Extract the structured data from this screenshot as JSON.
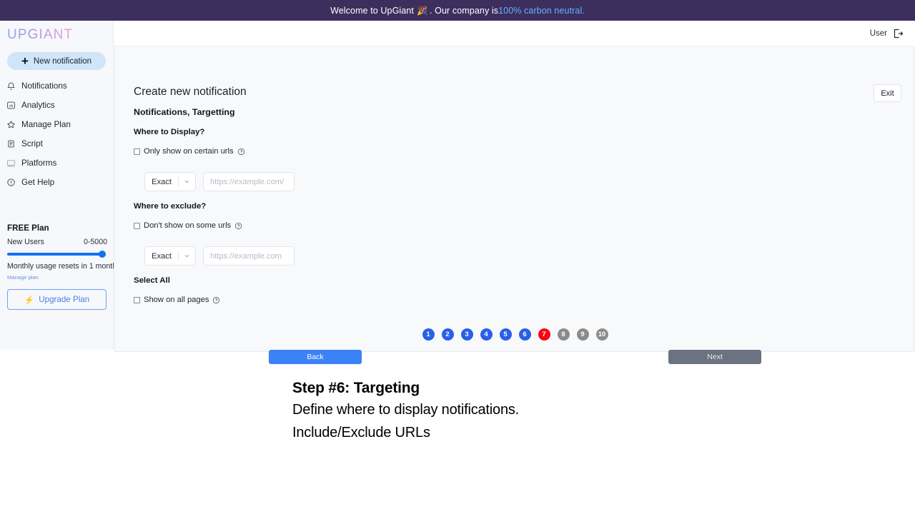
{
  "banner": {
    "text_before": "Welcome to UpGiant",
    "emoji": "🎉",
    "text_middle": ". Our company is ",
    "link_text": "100% carbon neutral.",
    "bg_color": "#3c2f5e",
    "link_color": "#66b2ff"
  },
  "sidebar": {
    "logo": "UPGIANT",
    "new_notification_label": "New notification",
    "items": [
      {
        "label": "Notifications",
        "icon": "bell-icon"
      },
      {
        "label": "Analytics",
        "icon": "analytics-icon"
      },
      {
        "label": "Manage Plan",
        "icon": "star-icon"
      },
      {
        "label": "Script",
        "icon": "script-icon"
      },
      {
        "label": "Platforms",
        "icon": "platforms-icon"
      },
      {
        "label": "Get Help",
        "icon": "help-circle-icon"
      }
    ],
    "plan": {
      "title": "FREE Plan",
      "usage_label": "New Users",
      "usage_value": "0-5000",
      "slider_percent": 100,
      "reset_note": "Monthly usage resets in 1 month",
      "manage_link": "Manage plan",
      "upgrade_label": "Upgrade Plan",
      "upgrade_emoji": "⚡",
      "accent_color": "#1273ed"
    }
  },
  "topbar": {
    "user_label": "User",
    "logout_icon": "logout-icon"
  },
  "main": {
    "page_title": "Create new notification",
    "section_subtitle": "Notifications, Targetting",
    "exit_label": "Exit",
    "groups": [
      {
        "label": "Where to Display?",
        "checkbox_label": "Only show on certain urls",
        "checked": false,
        "match_mode": "Exact",
        "url_placeholder": "https://example.com/",
        "url_value": ""
      },
      {
        "label": "Where to exclude?",
        "checkbox_label": "Don't show on some urls",
        "checked": false,
        "match_mode": "Exact",
        "url_placeholder": "https://example.com",
        "url_value": ""
      }
    ],
    "select_all": {
      "label": "Select All",
      "checkbox_label": "Show on all pages",
      "checked": false
    },
    "steps": [
      {
        "number": "1",
        "state": "done"
      },
      {
        "number": "2",
        "state": "done"
      },
      {
        "number": "3",
        "state": "done"
      },
      {
        "number": "4",
        "state": "done"
      },
      {
        "number": "5",
        "state": "done"
      },
      {
        "number": "6",
        "state": "done"
      },
      {
        "number": "7",
        "state": "current"
      },
      {
        "number": "8",
        "state": "todo"
      },
      {
        "number": "9",
        "state": "todo"
      },
      {
        "number": "10",
        "state": "todo"
      }
    ],
    "back_label": "Back",
    "next_label": "Next",
    "colors": {
      "step_done": "#2a5fe8",
      "step_current": "#fc0511",
      "step_todo": "#8b8b8b",
      "back": "#3b82f6",
      "next": "#6b7280"
    }
  },
  "caption": {
    "heading": "Step #6: Targeting",
    "line1": "Define where to display notifications.",
    "line2": "Include/Exclude URLs"
  }
}
